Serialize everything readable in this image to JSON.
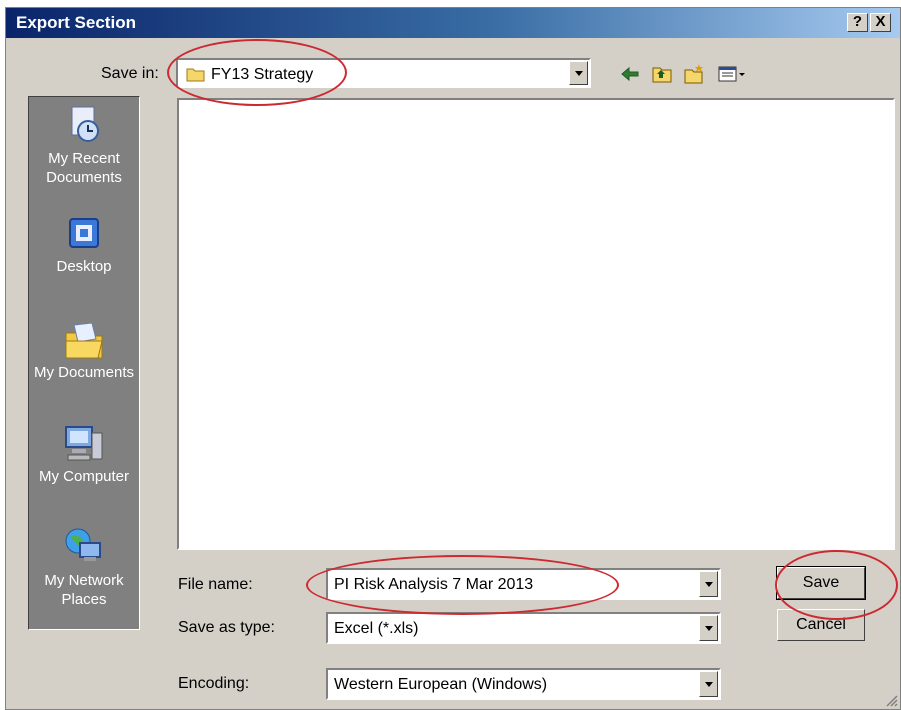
{
  "window": {
    "title": "Export Section",
    "help_button": "?",
    "close_button": "X"
  },
  "save_in": {
    "label": "Save in:",
    "value": "FY13 Strategy"
  },
  "toolbar": {
    "icons": [
      "back-arrow-icon",
      "up-folder-icon",
      "new-folder-icon",
      "view-menu-icon"
    ]
  },
  "places_bar": {
    "items": [
      {
        "label_line1": "My Recent",
        "label_line2": "Documents",
        "icon": "recent-documents-icon"
      },
      {
        "label_line1": "Desktop",
        "label_line2": "",
        "icon": "desktop-icon"
      },
      {
        "label_line1": "My Documents",
        "label_line2": "",
        "icon": "my-documents-icon"
      },
      {
        "label_line1": "My Computer",
        "label_line2": "",
        "icon": "my-computer-icon"
      },
      {
        "label_line1": "My Network",
        "label_line2": "Places",
        "icon": "network-places-icon"
      }
    ]
  },
  "file_name": {
    "label": "File name:",
    "value": "PI Risk Analysis 7 Mar 2013"
  },
  "save_as_type": {
    "label": "Save as type:",
    "value": "Excel (*.xls)"
  },
  "encoding": {
    "label": "Encoding:",
    "value": "Western European (Windows)"
  },
  "buttons": {
    "save": "Save",
    "cancel": "Cancel"
  },
  "colors": {
    "title_bar": "#0a246a",
    "dialog_face": "#d4d0c8",
    "places_bar": "#808080",
    "annotation": "#cc2a30"
  }
}
